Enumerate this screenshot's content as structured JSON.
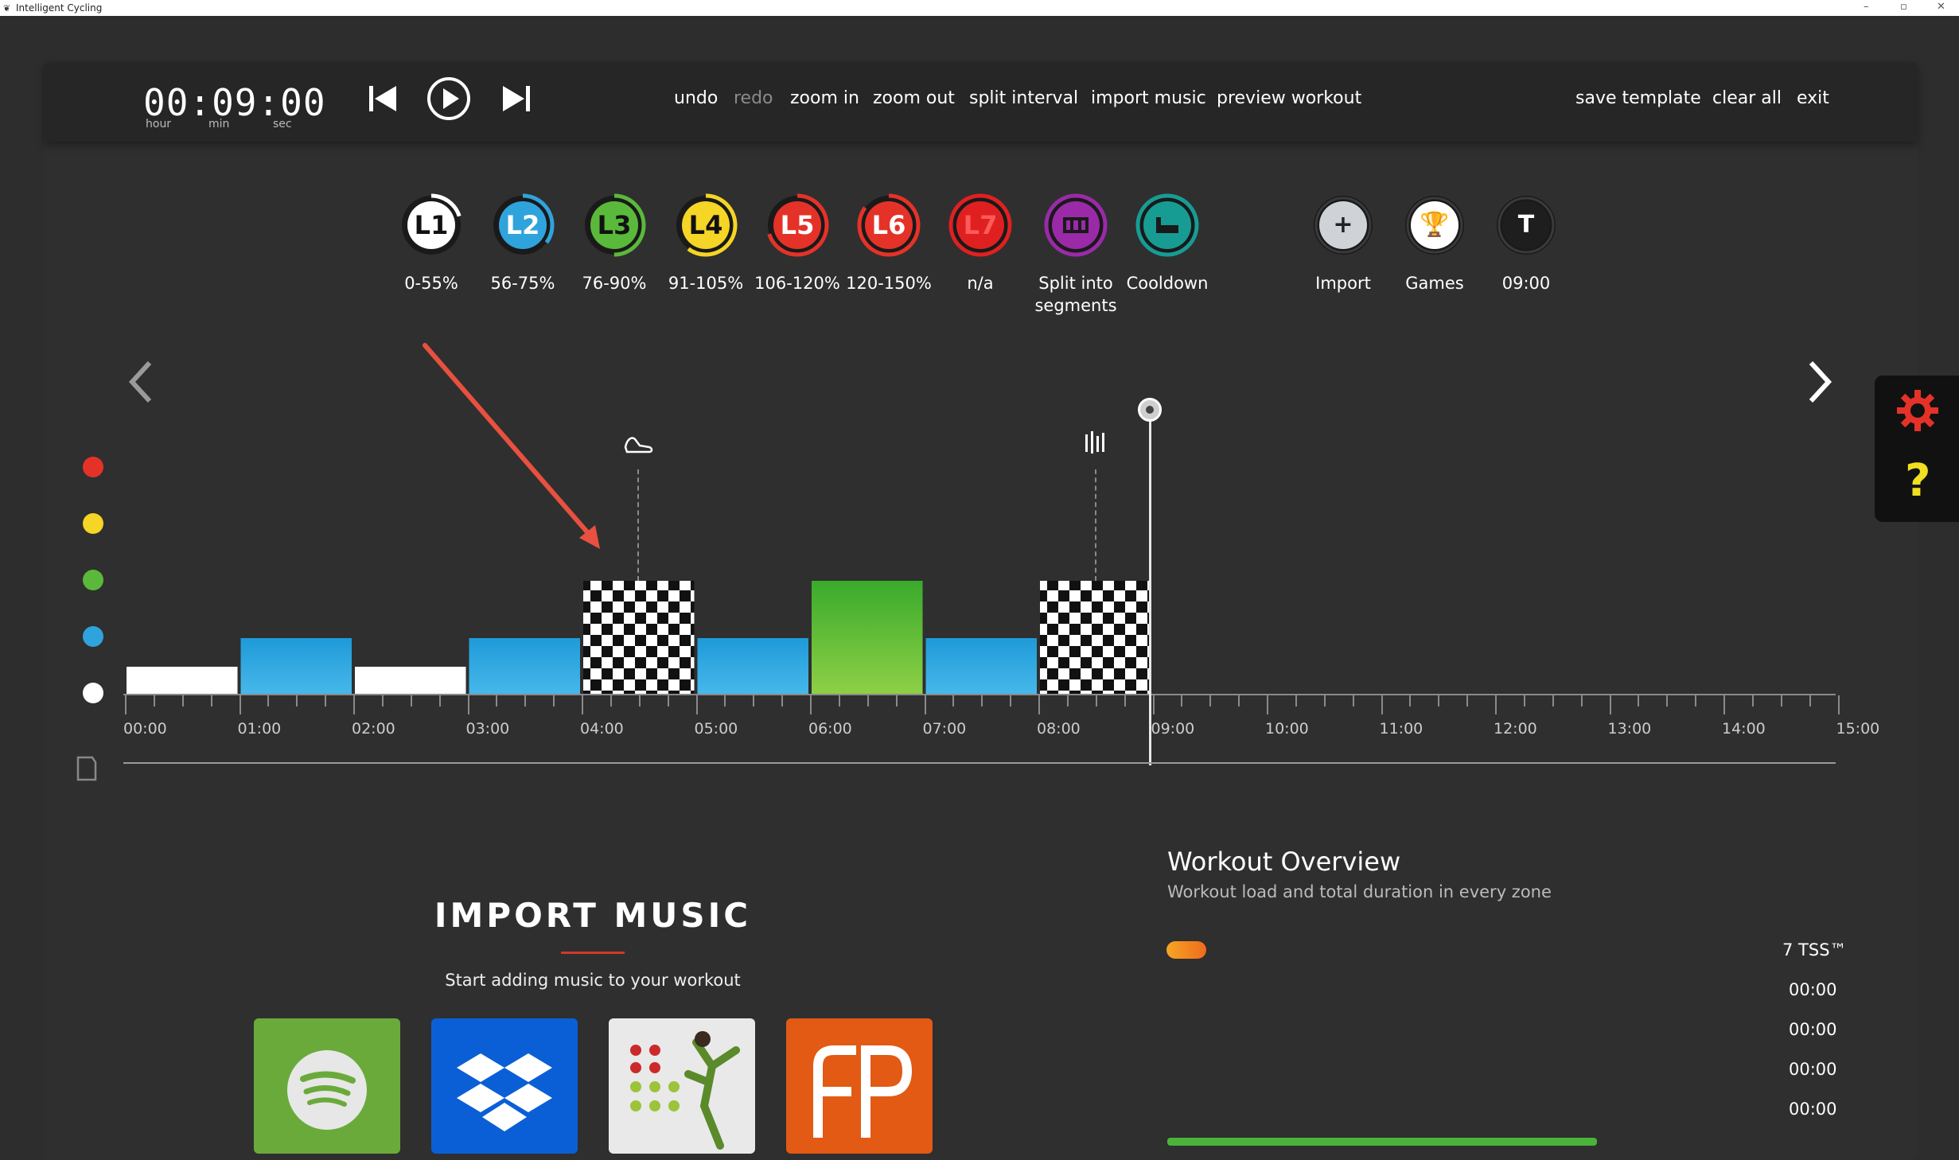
{
  "window": {
    "title": "Intelligent Cycling",
    "min": "–",
    "restore": "▫",
    "close": "✕"
  },
  "timer": {
    "display": "00:09:00",
    "hour_label": "hour",
    "min_label": "min",
    "sec_label": "sec"
  },
  "toolbar": {
    "undo": "undo",
    "redo": "redo",
    "zoom_in": "zoom in",
    "zoom_out": "zoom out",
    "split_interval": "split interval",
    "import_music": "import music",
    "preview_workout": "preview workout",
    "save_template": "save template",
    "clear_all": "clear all",
    "exit": "exit"
  },
  "zones": [
    {
      "code": "L1",
      "label": "0-55%",
      "fill": "#ffffff",
      "text": "#111111",
      "ring": "#ffffff",
      "progress": 0.2
    },
    {
      "code": "L2",
      "label": "56-75%",
      "fill": "#2fa3dc",
      "text": "#ffffff",
      "ring": "#2fa3dc",
      "progress": 0.35
    },
    {
      "code": "L3",
      "label": "76-90%",
      "fill": "#5ab93a",
      "text": "#111111",
      "ring": "#5ab93a",
      "progress": 0.5
    },
    {
      "code": "L4",
      "label": "91-105%",
      "fill": "#f5d525",
      "text": "#111111",
      "ring": "#f5d525",
      "progress": 0.6
    },
    {
      "code": "L5",
      "label": "106-120%",
      "fill": "#e53228",
      "text": "#ffffff",
      "ring": "#e53228",
      "progress": 0.7
    },
    {
      "code": "L6",
      "label": "120-150%",
      "fill": "#e53228",
      "text": "#ffffff",
      "ring": "#e53228",
      "progress": 0.85
    },
    {
      "code": "L7",
      "label": "n/a",
      "fill": "#e02020",
      "text": "#ff5a5a",
      "ring": "#e02020",
      "progress": 1.0
    }
  ],
  "special_tools": [
    {
      "name": "split",
      "label": "Split into segments",
      "fill": "#9a2aa8",
      "ring": "#9a2aa8"
    },
    {
      "name": "cooldown",
      "label": "Cooldown",
      "fill": "#179c94",
      "ring": "#179c94"
    }
  ],
  "extra_tools": [
    {
      "name": "import",
      "label": "Import",
      "fill": "#cfd3d8",
      "glyph": "+"
    },
    {
      "name": "games",
      "label": "Games",
      "fill": "#ffffff",
      "glyph": "🏆"
    },
    {
      "name": "time",
      "label": "09:00",
      "fill": "#1e1e1e",
      "glyph": "T"
    }
  ],
  "zone_dots": [
    "#e53228",
    "#f5d525",
    "#5ab93a",
    "#2fa3dc",
    "#ffffff"
  ],
  "intervals": [
    {
      "start": 0,
      "end": 1,
      "zone": "L1"
    },
    {
      "start": 1,
      "end": 2,
      "zone": "L2"
    },
    {
      "start": 2,
      "end": 3,
      "zone": "L1"
    },
    {
      "start": 3,
      "end": 4,
      "zone": "L2"
    },
    {
      "start": 4,
      "end": 5,
      "zone": "sprint"
    },
    {
      "start": 5,
      "end": 6,
      "zone": "L2"
    },
    {
      "start": 6,
      "end": 7,
      "zone": "L3"
    },
    {
      "start": 7,
      "end": 8,
      "zone": "L2"
    },
    {
      "start": 8,
      "end": 9,
      "zone": "sprint"
    }
  ],
  "axis_labels": [
    "00:00",
    "01:00",
    "02:00",
    "03:00",
    "04:00",
    "05:00",
    "06:00",
    "07:00",
    "08:00",
    "09:00",
    "10:00",
    "11:00",
    "12:00",
    "13:00",
    "14:00",
    "15:00"
  ],
  "cursor_minute": 9,
  "import_music": {
    "title": "IMPORT MUSIC",
    "subtitle": "Start adding music to your workout",
    "sources": [
      {
        "name": "spotify",
        "bg": "#6aaa3b"
      },
      {
        "name": "dropbox",
        "bg": "#0a5fd6"
      },
      {
        "name": "fitness",
        "bg": "#e9e9e9"
      },
      {
        "name": "fp",
        "bg": "#e25a14"
      }
    ]
  },
  "overview": {
    "title": "Workout Overview",
    "subtitle": "Workout load and total duration in every zone",
    "tss": "7 TSS™",
    "times": [
      "00:00",
      "00:00",
      "00:00",
      "00:00"
    ]
  }
}
